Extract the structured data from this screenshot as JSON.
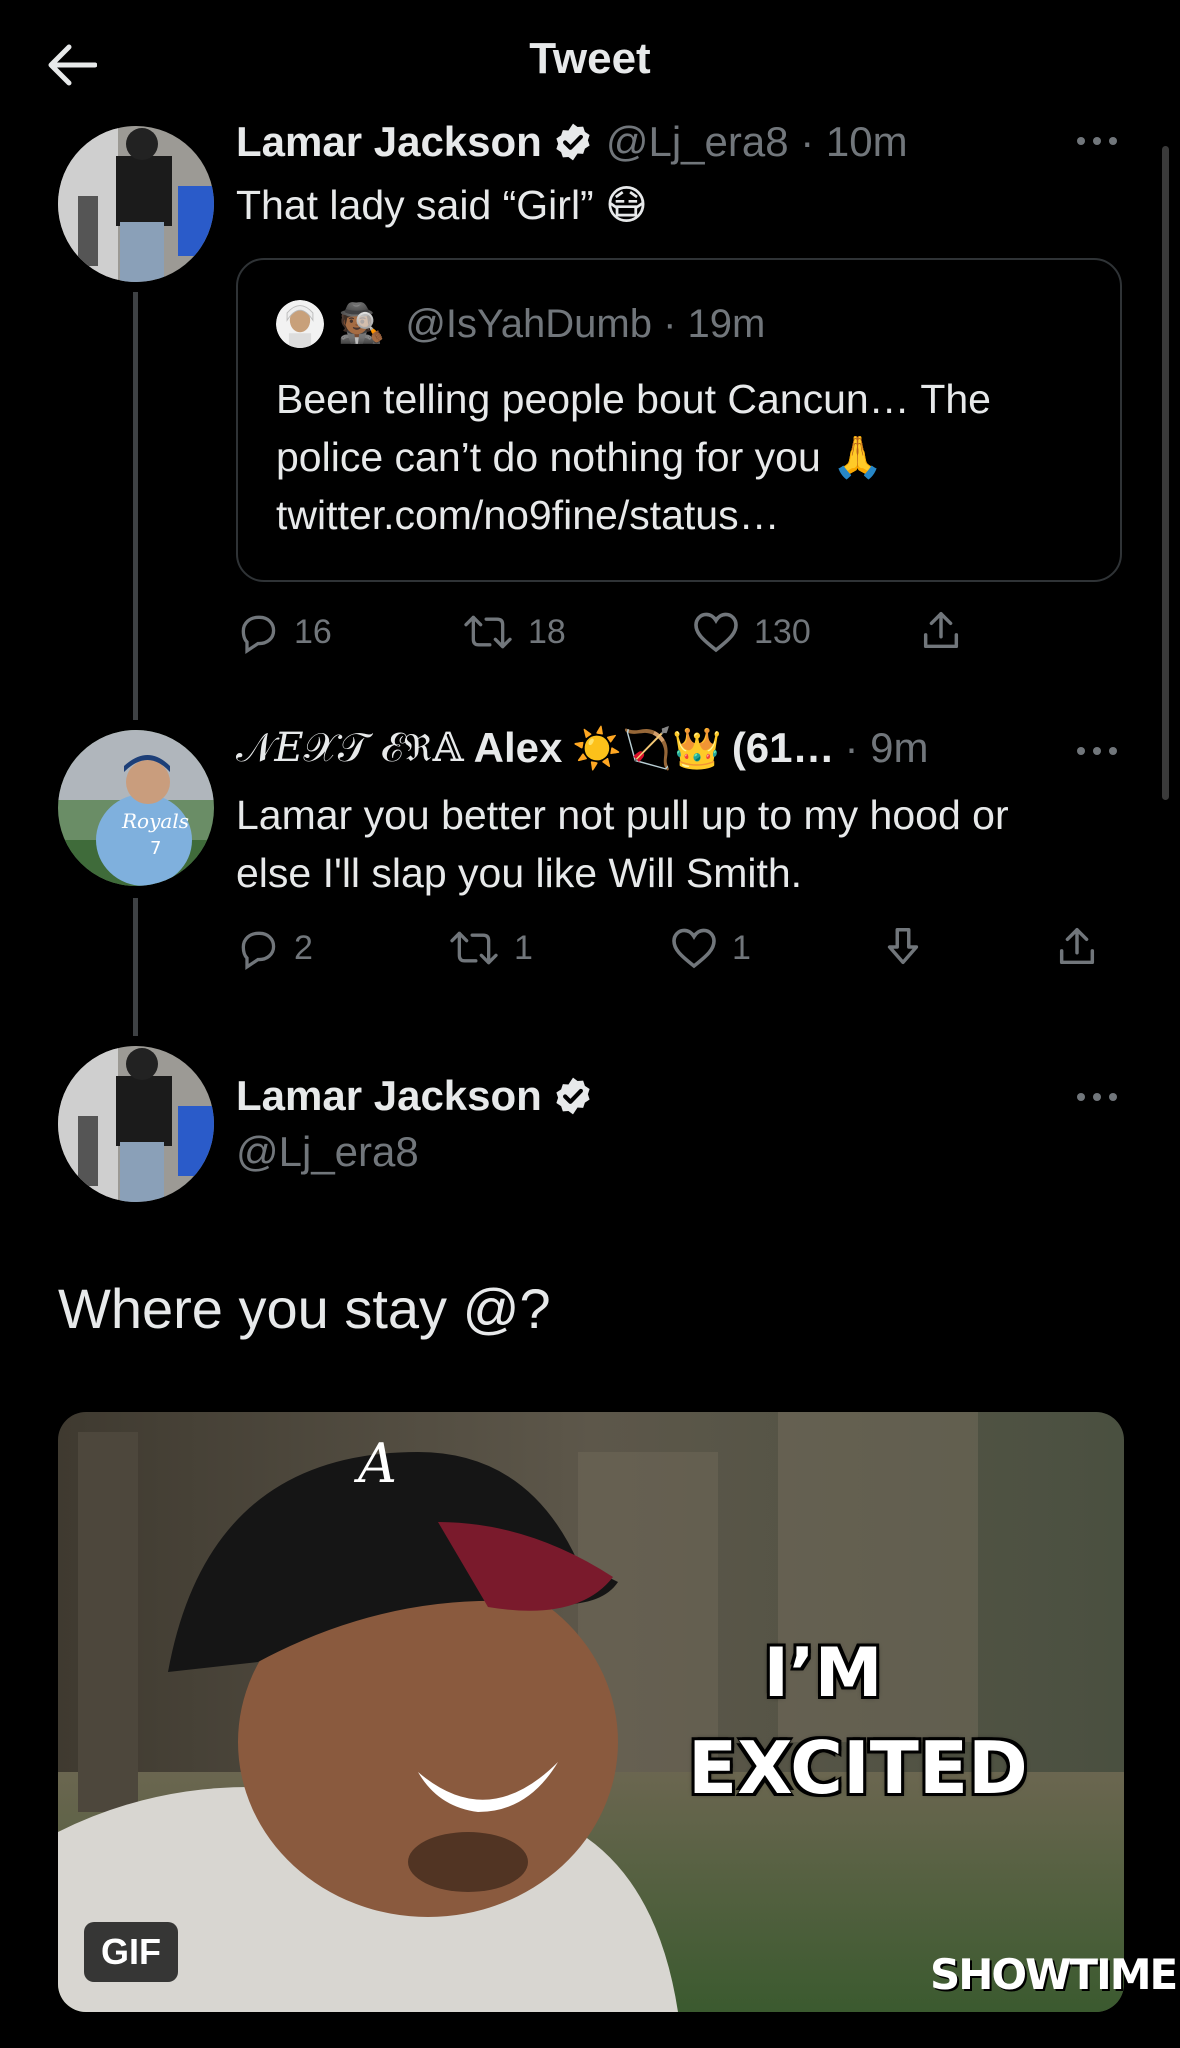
{
  "header": {
    "title": "Tweet"
  },
  "tweet1": {
    "name": "Lamar Jackson",
    "handle": "@Lj_era8 · 10m",
    "text": "That lady said “Girl” 😷",
    "quote": {
      "handle": "@IsYahDumb · 19m",
      "line1": "Been telling people bout Cancun… The",
      "line2": "police can’t do nothing for you 🙏",
      "line3": "twitter.com/no9fine/status…"
    },
    "replies": "16",
    "retweets": "18",
    "likes": "130"
  },
  "tweet2": {
    "name_styled": "𝒩𝐸𝒳𝒯 ℰℜ𝔸",
    "name": "Alex",
    "emoji": "☀️🏹👑",
    "name_suffix": "(61…",
    "time": "· 9m",
    "line1": "Lamar you better not pull up to my hood or",
    "line2": "else I'll slap you like Will Smith.",
    "replies": "2",
    "retweets": "1",
    "likes": "1"
  },
  "tweet3": {
    "name": "Lamar Jackson",
    "handle": "@Lj_era8",
    "text": "Where you stay @?",
    "media": {
      "badge": "GIF",
      "caption_line1": "I’M",
      "caption_line2": "EXCITED",
      "watermark": "SHOWTIME"
    }
  },
  "colors": {
    "background": "#000000",
    "text": "#e7e9ea",
    "secondary": "#71767b",
    "verified": "#e7e9ea"
  }
}
